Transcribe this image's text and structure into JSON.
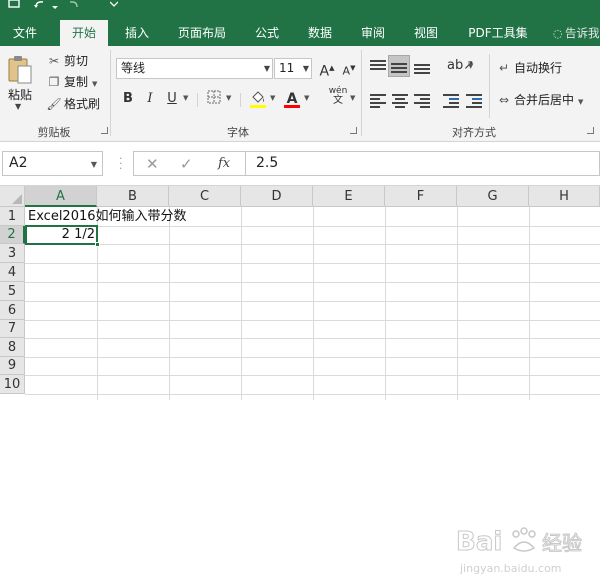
{
  "quick_access": {
    "save_icon": "save-icon",
    "undo_icon": "undo-icon",
    "redo_icon": "redo-icon"
  },
  "tabs": [
    {
      "label": "文件",
      "active": false
    },
    {
      "label": "开始",
      "active": true
    },
    {
      "label": "插入",
      "active": false
    },
    {
      "label": "页面布局",
      "active": false
    },
    {
      "label": "公式",
      "active": false
    },
    {
      "label": "数据",
      "active": false
    },
    {
      "label": "审阅",
      "active": false
    },
    {
      "label": "视图",
      "active": false
    },
    {
      "label": "PDF工具集",
      "active": false
    }
  ],
  "tell_me": "告诉我",
  "clipboard": {
    "paste": "粘贴",
    "cut": "剪切",
    "copy": "复制",
    "format_painter": "格式刷",
    "group_label": "剪贴板"
  },
  "font": {
    "name": "等线",
    "size": "11",
    "group_label": "字体",
    "bold": "B",
    "italic": "I",
    "underline": "U",
    "grow": "A",
    "shrink": "A",
    "phonetic": "wén"
  },
  "alignment": {
    "wrap_text": "自动换行",
    "merge_center": "合并后居中",
    "group_label": "对齐方式"
  },
  "formula_bar": {
    "name_box": "A2",
    "formula": "2.5",
    "fx": "fx"
  },
  "columns": [
    "A",
    "B",
    "C",
    "D",
    "E",
    "F",
    "G",
    "H"
  ],
  "rows": [
    "1",
    "2",
    "3",
    "4",
    "5",
    "6",
    "7",
    "8",
    "9",
    "10"
  ],
  "cells": {
    "A1": "Excel2016如何输入带分数",
    "A2": "2 1/2"
  },
  "selection": {
    "cell": "A2",
    "column": "A",
    "row": "2"
  },
  "colors": {
    "accent": "#217346",
    "font_highlight": "#ffff00",
    "font_color": "#ff0000"
  },
  "watermark": {
    "text": "Bai 经验",
    "sub": "jingyan.baidu.com"
  }
}
